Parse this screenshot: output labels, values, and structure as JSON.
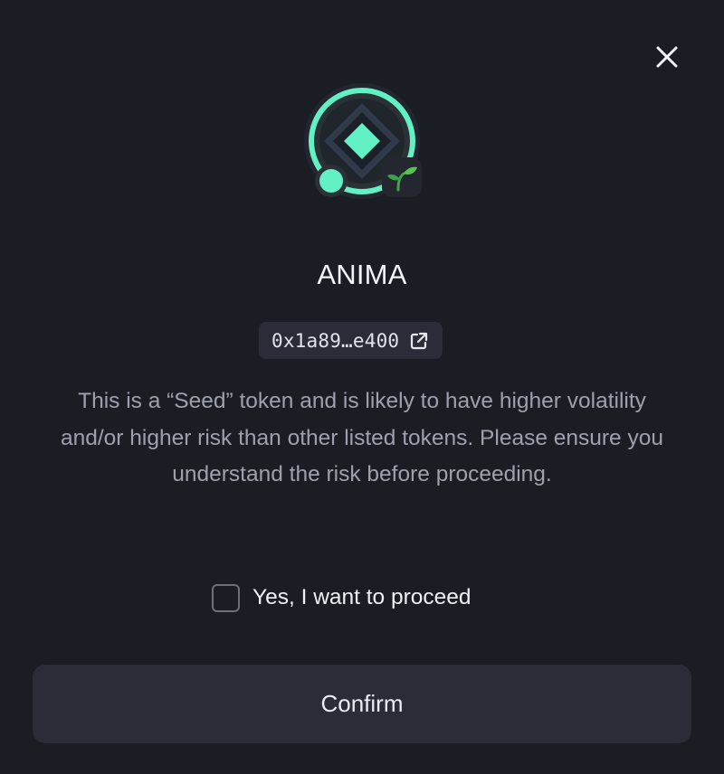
{
  "token": {
    "name": "ANIMA",
    "address_short": "0x1a89…e400",
    "badge": "seed-sprout-icon",
    "logo": "anima-token-logo"
  },
  "warning": {
    "text": "This is a “Seed” token and is likely to have higher volatility and/or higher risk than other listed tokens. Please ensure you understand the risk before proceeding."
  },
  "consent": {
    "label": "Yes, I want to proceed",
    "checked": false
  },
  "actions": {
    "confirm_label": "Confirm",
    "close_icon": "close-icon",
    "external_link_icon": "external-link-icon"
  },
  "colors": {
    "background": "#1b1d25",
    "surface": "#2a2d38",
    "accent": "#62f1c5",
    "muted_text": "#9ca2ad"
  }
}
